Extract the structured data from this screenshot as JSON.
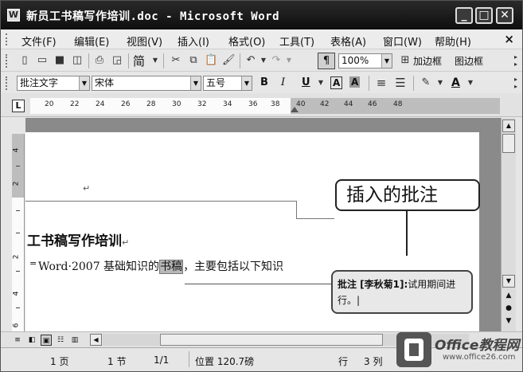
{
  "window": {
    "title": "新员工书稿写作培训.doc - Microsoft Word"
  },
  "menu": {
    "items": [
      "文件(F)",
      "编辑(E)",
      "视图(V)",
      "插入(I)",
      "格式(O)",
      "工具(T)",
      "表格(A)",
      "窗口(W)",
      "帮助(H)"
    ]
  },
  "toolbar1": {
    "font_mode": "简",
    "zoom": "100%",
    "draw_table": "加边框",
    "borders": "图边框"
  },
  "toolbar2": {
    "style": "批注文字",
    "font": "宋体",
    "size": "五号",
    "bold": "B",
    "italic": "I",
    "underline": "U",
    "charborder": "A",
    "charshade": "A",
    "fontcolor": "A"
  },
  "ruler": {
    "numbers": [
      "20",
      "22",
      "24",
      "26",
      "28",
      "30",
      "32",
      "34",
      "36",
      "38",
      "40",
      "42",
      "44",
      "46",
      "48"
    ],
    "tab": "L"
  },
  "vruler": {
    "numbers": [
      "4",
      "2",
      "2",
      "4",
      "6"
    ]
  },
  "document": {
    "heading": "工书稿写作培训",
    "body_before": "Word·2007 基础知识的",
    "body_highlight": "书稿",
    "body_after": "，主要包括以下知识"
  },
  "comment": {
    "label": "批注 [李秋菊1]:",
    "text": "试用期间进行。"
  },
  "callout": {
    "text": "插入的批注"
  },
  "status": {
    "page": "1 页",
    "section": "1 节",
    "pages": "1/1",
    "position": "位置 120.7磅",
    "line": "行",
    "col": "3 列"
  },
  "logo": {
    "brand": "Office教程网",
    "url": "www.office26.com"
  }
}
